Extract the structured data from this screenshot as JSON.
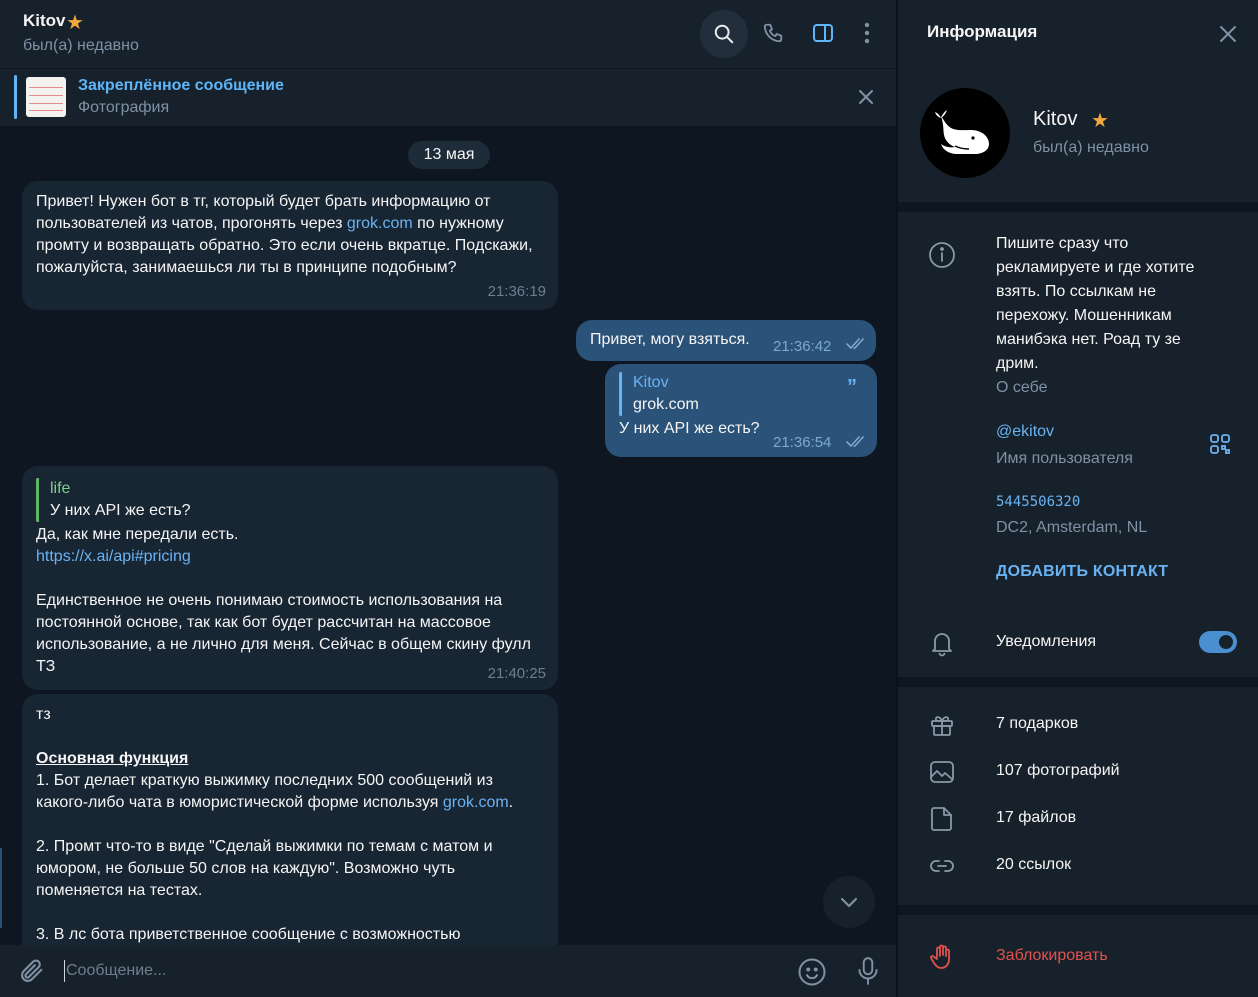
{
  "header": {
    "name": "Kitov",
    "status": "был(а) недавно"
  },
  "pinned": {
    "title": "Закреплённое сообщение",
    "subtitle": "Фотография"
  },
  "date_chip": "13 мая",
  "messages": {
    "m1": {
      "text_before": "Привет! Нужен бот в тг, который будет брать информацию от пользователей из чатов, прогонять через ",
      "link": "grok.com",
      "text_after": " по нужному промту и возвращать обратно. Это если очень вкратце. Подскажи, пожалуйста, занимаешься ли ты в принципе подобным?",
      "time": "21:36:19"
    },
    "m2": {
      "text": "Привет, могу взяться.",
      "time": "21:36:42"
    },
    "m3": {
      "reply_name": "Kitov",
      "reply_text": "grok.com",
      "text": "У них API же есть?",
      "time": "21:36:54"
    },
    "m4": {
      "reply_name": "life",
      "reply_text": "У них API же есть?",
      "line1": "Да, как мне передали есть.",
      "link": "https://x.ai/api#pricing",
      "body": "Единственное не очень понимаю стоимость использования на постоянной основе, так как бот будет рассчитан на массовое использование, а не лично для меня. Сейчас в общем скину фулл ТЗ",
      "time": "21:40:25"
    },
    "m5": {
      "l1": "тз",
      "heading": "Основная функция",
      "p1_before": "1. Бот делает краткую выжимку последних 500 сообщений из какого-либо чата в юмористической форме используя ",
      "p1_link": "grok.com",
      "p1_after": ".",
      "p2": "2. Промт что-то в виде \"Сделай выжимки по темам с матом и юмором, не больше 50 слов на каждую\". Возможно чуть поменяется на тестах.",
      "p3": "3. В лс бота приветственное сообщение с возможностью"
    }
  },
  "composer": {
    "placeholder": "Сообщение..."
  },
  "info": {
    "title": "Информация",
    "name": "Kitov",
    "status": "был(а) недавно",
    "bio": "Пишите сразу что рекламируете и где хотите взять. По ссылкам не перехожу. Мошенникам манибэка нет. Роад ту зе дрим.",
    "bio_caption": "О себе",
    "username": "@ekitov",
    "username_caption": "Имя пользователя",
    "phone": "5445506320",
    "phone_caption": "DC2, Amsterdam, NL",
    "add_contact": "ДОБАВИТЬ КОНТАКТ",
    "notifications": "Уведомления",
    "notifications_on": true,
    "gifts": "7 подарков",
    "photos": "107 фотографий",
    "files": "17 файлов",
    "links": "20 ссылок",
    "block": "Заблокировать"
  },
  "colors": {
    "bg": "#0e1621",
    "panel": "#17212b",
    "bubble_in": "#182533",
    "bubble_out": "#2b5278",
    "accent": "#6ab3f3",
    "star": "#f3a73a",
    "danger": "#e0524f"
  }
}
